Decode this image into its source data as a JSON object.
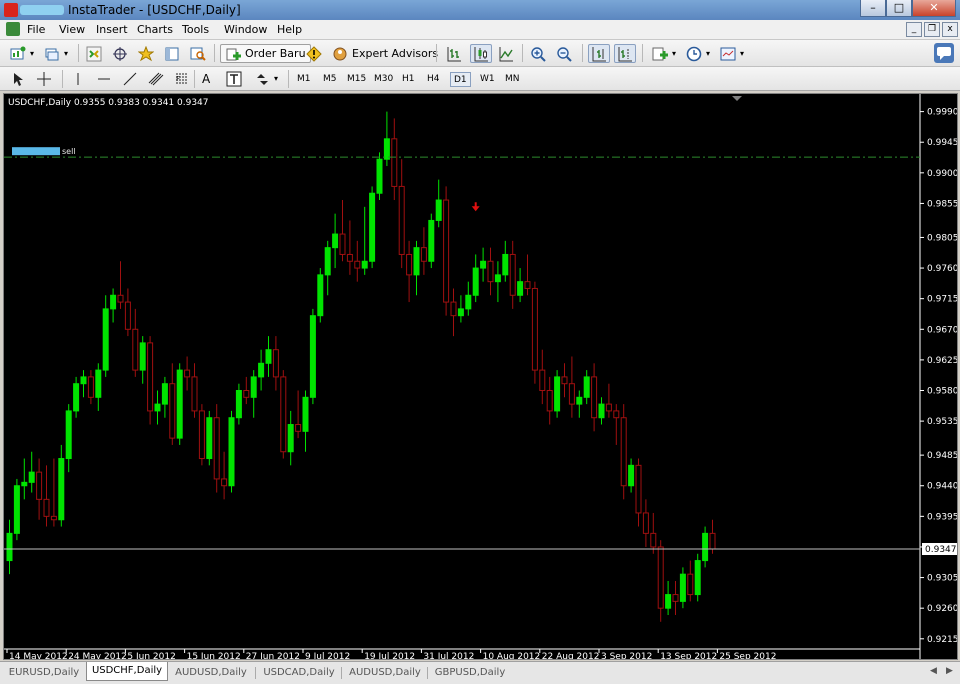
{
  "window": {
    "title": "InstaTrader - [USDCHF,Daily]"
  },
  "menu": [
    "File",
    "View",
    "Insert",
    "Charts",
    "Tools",
    "Window",
    "Help"
  ],
  "toolbar": {
    "order_label": "Order Baru",
    "expert_label": "Expert Advisors"
  },
  "timeframes": [
    "M1",
    "M5",
    "M15",
    "M30",
    "H1",
    "H4",
    "D1",
    "W1",
    "MN"
  ],
  "active_timeframe": "D1",
  "chart": {
    "info": "USDCHF,Daily  0.9355 0.9383 0.9341 0.9347",
    "order_label": "sell",
    "order_level": 0.9923,
    "current_price": "0.9347",
    "current_price_value": 0.9347,
    "y_ticks": [
      "0.9990",
      "0.9945",
      "0.9900",
      "0.9855",
      "0.9805",
      "0.9760",
      "0.9715",
      "0.9670",
      "0.9625",
      "0.9580",
      "0.9535",
      "0.9485",
      "0.9440",
      "0.9395",
      "0.9350",
      "0.9305",
      "0.9260",
      "0.9215"
    ],
    "x_ticks": [
      "14 May 2012",
      "24 May 2012",
      "5 Jun 2012",
      "15 Jun 2012",
      "27 Jun 2012",
      "9 Jul 2012",
      "19 Jul 2012",
      "31 Jul 2012",
      "10 Aug 2012",
      "22 Aug 2012",
      "3 Sep 2012",
      "13 Sep 2012",
      "25 Sep 2012"
    ],
    "colors": {
      "bull": "#00e400",
      "bear": "#a01010",
      "axis": "#ffffff",
      "order_line": "#2e8b2e",
      "price_line": "#c0c0c0",
      "arrow": "#e01010"
    }
  },
  "chart_data": {
    "type": "candlestick",
    "symbol": "USDCHF",
    "period": "Daily",
    "ylim": [
      0.92,
      1.001
    ],
    "ohlc": [
      [
        0.933,
        0.939,
        0.931,
        0.937
      ],
      [
        0.937,
        0.945,
        0.936,
        0.944
      ],
      [
        0.944,
        0.948,
        0.942,
        0.9445
      ],
      [
        0.9445,
        0.949,
        0.943,
        0.946
      ],
      [
        0.946,
        0.948,
        0.939,
        0.942
      ],
      [
        0.942,
        0.947,
        0.938,
        0.9395
      ],
      [
        0.9395,
        0.948,
        0.938,
        0.939
      ],
      [
        0.939,
        0.95,
        0.938,
        0.948
      ],
      [
        0.948,
        0.956,
        0.946,
        0.955
      ],
      [
        0.955,
        0.96,
        0.954,
        0.959
      ],
      [
        0.959,
        0.961,
        0.957,
        0.96
      ],
      [
        0.96,
        0.961,
        0.956,
        0.957
      ],
      [
        0.957,
        0.962,
        0.955,
        0.961
      ],
      [
        0.961,
        0.972,
        0.96,
        0.97
      ],
      [
        0.97,
        0.973,
        0.968,
        0.972
      ],
      [
        0.972,
        0.977,
        0.97,
        0.971
      ],
      [
        0.971,
        0.973,
        0.966,
        0.967
      ],
      [
        0.967,
        0.97,
        0.96,
        0.961
      ],
      [
        0.961,
        0.966,
        0.959,
        0.965
      ],
      [
        0.965,
        0.966,
        0.953,
        0.955
      ],
      [
        0.955,
        0.958,
        0.953,
        0.956
      ],
      [
        0.956,
        0.96,
        0.954,
        0.959
      ],
      [
        0.959,
        0.962,
        0.95,
        0.951
      ],
      [
        0.951,
        0.962,
        0.95,
        0.961
      ],
      [
        0.961,
        0.963,
        0.958,
        0.96
      ],
      [
        0.96,
        0.962,
        0.954,
        0.955
      ],
      [
        0.955,
        0.956,
        0.947,
        0.948
      ],
      [
        0.948,
        0.955,
        0.947,
        0.954
      ],
      [
        0.954,
        0.956,
        0.943,
        0.945
      ],
      [
        0.945,
        0.949,
        0.942,
        0.944
      ],
      [
        0.944,
        0.955,
        0.943,
        0.954
      ],
      [
        0.954,
        0.959,
        0.953,
        0.958
      ],
      [
        0.958,
        0.96,
        0.956,
        0.957
      ],
      [
        0.957,
        0.961,
        0.954,
        0.96
      ],
      [
        0.96,
        0.964,
        0.958,
        0.962
      ],
      [
        0.962,
        0.966,
        0.96,
        0.964
      ],
      [
        0.964,
        0.966,
        0.958,
        0.96
      ],
      [
        0.96,
        0.961,
        0.948,
        0.949
      ],
      [
        0.949,
        0.955,
        0.947,
        0.953
      ],
      [
        0.953,
        0.958,
        0.951,
        0.952
      ],
      [
        0.952,
        0.958,
        0.949,
        0.957
      ],
      [
        0.957,
        0.97,
        0.956,
        0.969
      ],
      [
        0.969,
        0.976,
        0.968,
        0.975
      ],
      [
        0.975,
        0.98,
        0.972,
        0.979
      ],
      [
        0.979,
        0.984,
        0.976,
        0.981
      ],
      [
        0.981,
        0.986,
        0.977,
        0.978
      ],
      [
        0.978,
        0.983,
        0.975,
        0.977
      ],
      [
        0.977,
        0.98,
        0.974,
        0.976
      ],
      [
        0.976,
        0.985,
        0.975,
        0.977
      ],
      [
        0.977,
        0.988,
        0.976,
        0.987
      ],
      [
        0.987,
        0.993,
        0.986,
        0.992
      ],
      [
        0.992,
        0.999,
        0.991,
        0.995
      ],
      [
        0.995,
        0.998,
        0.986,
        0.988
      ],
      [
        0.988,
        0.992,
        0.976,
        0.978
      ],
      [
        0.978,
        0.98,
        0.971,
        0.975
      ],
      [
        0.975,
        0.98,
        0.972,
        0.979
      ],
      [
        0.979,
        0.982,
        0.975,
        0.977
      ],
      [
        0.977,
        0.984,
        0.976,
        0.983
      ],
      [
        0.983,
        0.989,
        0.982,
        0.986
      ],
      [
        0.986,
        0.988,
        0.969,
        0.971
      ],
      [
        0.971,
        0.973,
        0.966,
        0.969
      ],
      [
        0.969,
        0.972,
        0.968,
        0.97
      ],
      [
        0.97,
        0.974,
        0.969,
        0.972
      ],
      [
        0.972,
        0.978,
        0.971,
        0.976
      ],
      [
        0.976,
        0.979,
        0.974,
        0.977
      ],
      [
        0.977,
        0.979,
        0.972,
        0.974
      ],
      [
        0.974,
        0.977,
        0.971,
        0.975
      ],
      [
        0.975,
        0.98,
        0.974,
        0.978
      ],
      [
        0.978,
        0.98,
        0.97,
        0.972
      ],
      [
        0.972,
        0.976,
        0.971,
        0.974
      ],
      [
        0.974,
        0.978,
        0.972,
        0.973
      ],
      [
        0.973,
        0.974,
        0.959,
        0.961
      ],
      [
        0.961,
        0.964,
        0.956,
        0.958
      ],
      [
        0.958,
        0.96,
        0.953,
        0.955
      ],
      [
        0.955,
        0.961,
        0.954,
        0.96
      ],
      [
        0.96,
        0.962,
        0.957,
        0.959
      ],
      [
        0.959,
        0.963,
        0.954,
        0.956
      ],
      [
        0.956,
        0.958,
        0.954,
        0.957
      ],
      [
        0.957,
        0.961,
        0.956,
        0.96
      ],
      [
        0.96,
        0.962,
        0.952,
        0.954
      ],
      [
        0.954,
        0.957,
        0.953,
        0.956
      ],
      [
        0.956,
        0.959,
        0.954,
        0.955
      ],
      [
        0.955,
        0.956,
        0.95,
        0.954
      ],
      [
        0.954,
        0.956,
        0.942,
        0.944
      ],
      [
        0.944,
        0.948,
        0.943,
        0.947
      ],
      [
        0.947,
        0.948,
        0.938,
        0.94
      ],
      [
        0.94,
        0.942,
        0.935,
        0.937
      ],
      [
        0.937,
        0.94,
        0.934,
        0.935
      ],
      [
        0.935,
        0.936,
        0.924,
        0.926
      ],
      [
        0.926,
        0.93,
        0.925,
        0.928
      ],
      [
        0.928,
        0.93,
        0.925,
        0.927
      ],
      [
        0.927,
        0.932,
        0.926,
        0.931
      ],
      [
        0.931,
        0.933,
        0.927,
        0.928
      ],
      [
        0.928,
        0.934,
        0.927,
        0.933
      ],
      [
        0.933,
        0.938,
        0.932,
        0.937
      ],
      [
        0.937,
        0.939,
        0.934,
        0.9347
      ]
    ],
    "markers": [
      {
        "type": "sell-arrow",
        "index": 63,
        "price": 0.9848
      }
    ]
  },
  "tabs": [
    "EURUSD,Daily",
    "USDCHF,Daily",
    "AUDUSD,Daily",
    "USDCAD,Daily",
    "AUDUSD,Daily",
    "GBPUSD,Daily"
  ],
  "active_tab": "USDCHF,Daily"
}
